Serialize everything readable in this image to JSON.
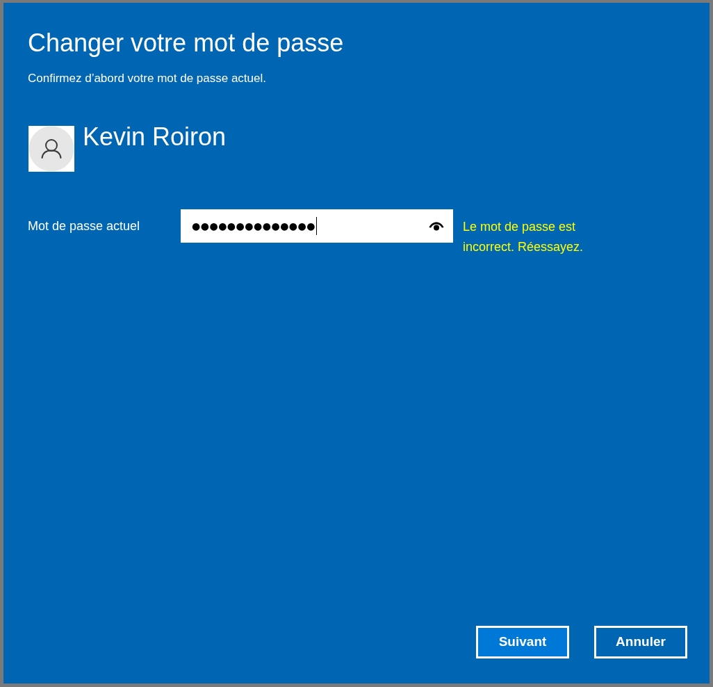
{
  "dialog": {
    "title": "Changer votre mot de passe",
    "subtitle": "Confirmez d’abord votre mot de passe actuel."
  },
  "account": {
    "name": "Kevin Roiron"
  },
  "password_field": {
    "label": "Mot de passe actuel",
    "value": "●●●●●●●●●●●●●●",
    "focused": true
  },
  "error": "Le mot de passe est incorrect. Réessayez.",
  "buttons": [
    {
      "label": "Suivant",
      "kind": "primary"
    },
    {
      "label": "Annuler",
      "kind": "secondary"
    }
  ]
}
